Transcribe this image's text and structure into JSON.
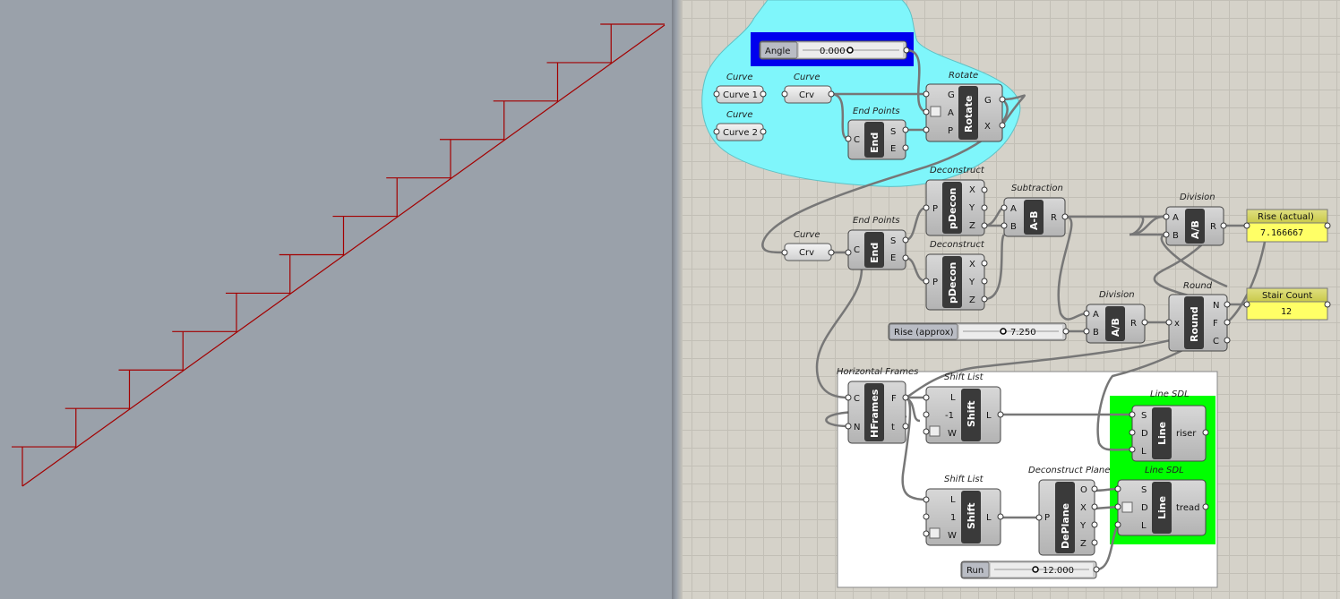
{
  "angle_slider": {
    "name": "Angle",
    "value": "0.000"
  },
  "rise_slider": {
    "name": "Rise (approx)",
    "value": "7.250"
  },
  "run_slider": {
    "name": "Run",
    "value": "12.000"
  },
  "captions": {
    "curve_a": "Curve",
    "curve_b": "Curve",
    "curve_c": "Curve",
    "curve_d": "Curve",
    "rotate": "Rotate",
    "endpoints_1": "End Points",
    "endpoints_2": "End Points",
    "deconstruct_1": "Deconstruct",
    "deconstruct_2": "Deconstruct",
    "subtraction": "Subtraction",
    "division_1": "Division",
    "division_2": "Division",
    "round": "Round",
    "hframes": "Horizontal Frames",
    "shift_1": "Shift List",
    "shift_2": "Shift List",
    "deplane": "Deconstruct Plane",
    "line_1": "Line SDL",
    "line_2": "Line SDL"
  },
  "params": {
    "curve1": "Curve 1",
    "curve2": "Curve 2",
    "crv1": "Crv",
    "crv2": "Crv"
  },
  "comps": {
    "rotate": "Rotate",
    "end": "End",
    "pdecon": "pDecon",
    "subtract": "A-B",
    "divide": "A/B",
    "round": "Round",
    "hframes": "HFrames",
    "shift": "Shift",
    "deplane": "DePlane",
    "line": "Line"
  },
  "ports": {
    "rotate_in": [
      "G",
      "A",
      "P"
    ],
    "rotate_out": [
      "G",
      "X"
    ],
    "end_in": "C",
    "end_out": [
      "S",
      "E"
    ],
    "pdecon_in": "P",
    "pdecon_out": [
      "X",
      "Y",
      "Z"
    ],
    "ab_in": [
      "A",
      "B"
    ],
    "r_out": "R",
    "round_in": "x",
    "round_out": [
      "N",
      "F",
      "C"
    ],
    "hframes_in": [
      "C",
      "N"
    ],
    "hframes_out": [
      "F",
      "t"
    ],
    "shift1_in": [
      "L",
      "-1",
      "W"
    ],
    "shift2_in": [
      "L",
      "1",
      "W"
    ],
    "shift_out": "L",
    "deplane_in": "P",
    "deplane_out": [
      "O",
      "X",
      "Y",
      "Z"
    ],
    "line_in": [
      "S",
      "D",
      "L"
    ],
    "line1_out": "riser",
    "line2_out": "tread"
  },
  "panels": {
    "rise_actual": {
      "title": "Rise (actual)",
      "value": "7.166667"
    },
    "stair_count": {
      "title": "Stair Count",
      "value": "12"
    }
  },
  "colors": {
    "viewport_bg": "#9aa1aa",
    "stair_line": "#a30000",
    "canvas_bg": "#d5d2c9",
    "blob": "#7ff6fb",
    "blue_group": "#0000ee",
    "green_group": "#00ff00",
    "white_group": "#ffffff",
    "panel_yellow": "#ffff66"
  },
  "stairs": {
    "count": 12
  }
}
